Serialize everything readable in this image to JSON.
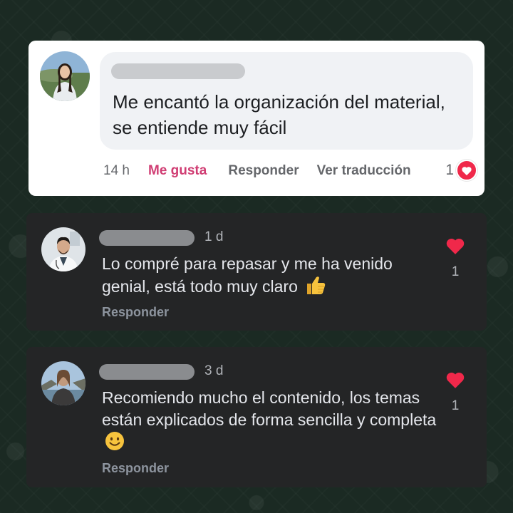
{
  "comments": [
    {
      "theme": "light",
      "text": "Me encantó la organización del material, se entiende muy fácil",
      "time": "14 h",
      "like_label": "Me gusta",
      "reply_label": "Responder",
      "translate_label": "Ver traducción",
      "reaction_count": "1",
      "accent_color": "#d03d73"
    },
    {
      "theme": "dark",
      "time": "1 d",
      "text": "Lo compré para repasar y me ha venido genial, está todo muy claro",
      "emoji": "thumbs-up",
      "reply_label": "Responder",
      "like_count": "1"
    },
    {
      "theme": "dark",
      "time": "3 d",
      "text": "Recomiendo mucho el contenido, los temas están explicados de forma sencilla y completa",
      "emoji": "smiling-face",
      "reply_label": "Responder",
      "like_count": "1"
    }
  ],
  "colors": {
    "heart_red": "#f0284a",
    "background": "#1b2a23",
    "dark_card": "#242526",
    "light_card": "#ffffff"
  }
}
